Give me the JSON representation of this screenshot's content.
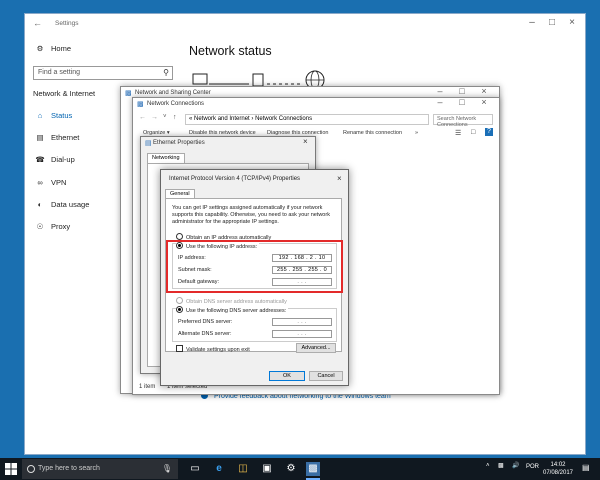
{
  "settings": {
    "window_title": "Settings",
    "search_placeholder": "Find a setting",
    "home_label": "Home",
    "section_label": "Network & Internet",
    "nav": [
      {
        "label": "Status",
        "icon": "home-network-icon"
      },
      {
        "label": "Ethernet",
        "icon": "ethernet-icon"
      },
      {
        "label": "Dial-up",
        "icon": "dialup-icon"
      },
      {
        "label": "VPN",
        "icon": "vpn-icon"
      },
      {
        "label": "Data usage",
        "icon": "data-usage-icon"
      },
      {
        "label": "Proxy",
        "icon": "globe-icon"
      }
    ],
    "page_title": "Network status",
    "feedback_link": "Provide feedback about networking to the Windows team"
  },
  "nsc": {
    "title": "Network and Sharing Center"
  },
  "nc": {
    "title": "Network Connections",
    "breadcrumb_prefix": "«",
    "breadcrumb_1": "Network and Internet",
    "breadcrumb_sep": "›",
    "breadcrumb_2": "Network Connections",
    "search_placeholder": "Search Network Connections",
    "commands": [
      "Organize ▾",
      "Disable this network device",
      "Diagnose this connection",
      "Rename this connection",
      "»"
    ],
    "status_items": "1 item",
    "status_selected": "1 item selected"
  },
  "eth": {
    "title": "Ethernet Properties",
    "tab": "Networking"
  },
  "ipv4": {
    "title": "Internet Protocol Version 4 (TCP/IPv4) Properties",
    "tab": "General",
    "info": "You can get IP settings assigned automatically if your network supports this capability. Otherwise, you need to ask your network administrator for the appropriate IP settings.",
    "obtain_ip_auto": "Obtain an IP address automatically",
    "use_following_ip": "Use the following IP address:",
    "ip_label": "IP address:",
    "ip_value": "192 . 168 . 2 . 10",
    "mask_label": "Subnet mask:",
    "mask_value": "255 . 255 . 255 . 0",
    "gateway_label": "Default gateway:",
    "gateway_value": ". . .",
    "obtain_dns_auto": "Obtain DNS server address automatically",
    "use_following_dns": "Use the following DNS server addresses:",
    "pref_dns_label": "Preferred DNS server:",
    "pref_dns_value": ". . .",
    "alt_dns_label": "Alternate DNS server:",
    "alt_dns_value": ". . .",
    "validate_label": "Validate settings upon exit",
    "advanced_button": "Advanced...",
    "ok_button": "OK",
    "cancel_button": "Cancel"
  },
  "taskbar": {
    "search_placeholder": "Type here to search",
    "lang": "POR",
    "time": "14:02",
    "date": "07/08/2017"
  },
  "colors": {
    "accent": "#0063b1",
    "highlight": "#e32a2a",
    "desktop": "#1a6fb0",
    "taskbar": "#101820"
  }
}
